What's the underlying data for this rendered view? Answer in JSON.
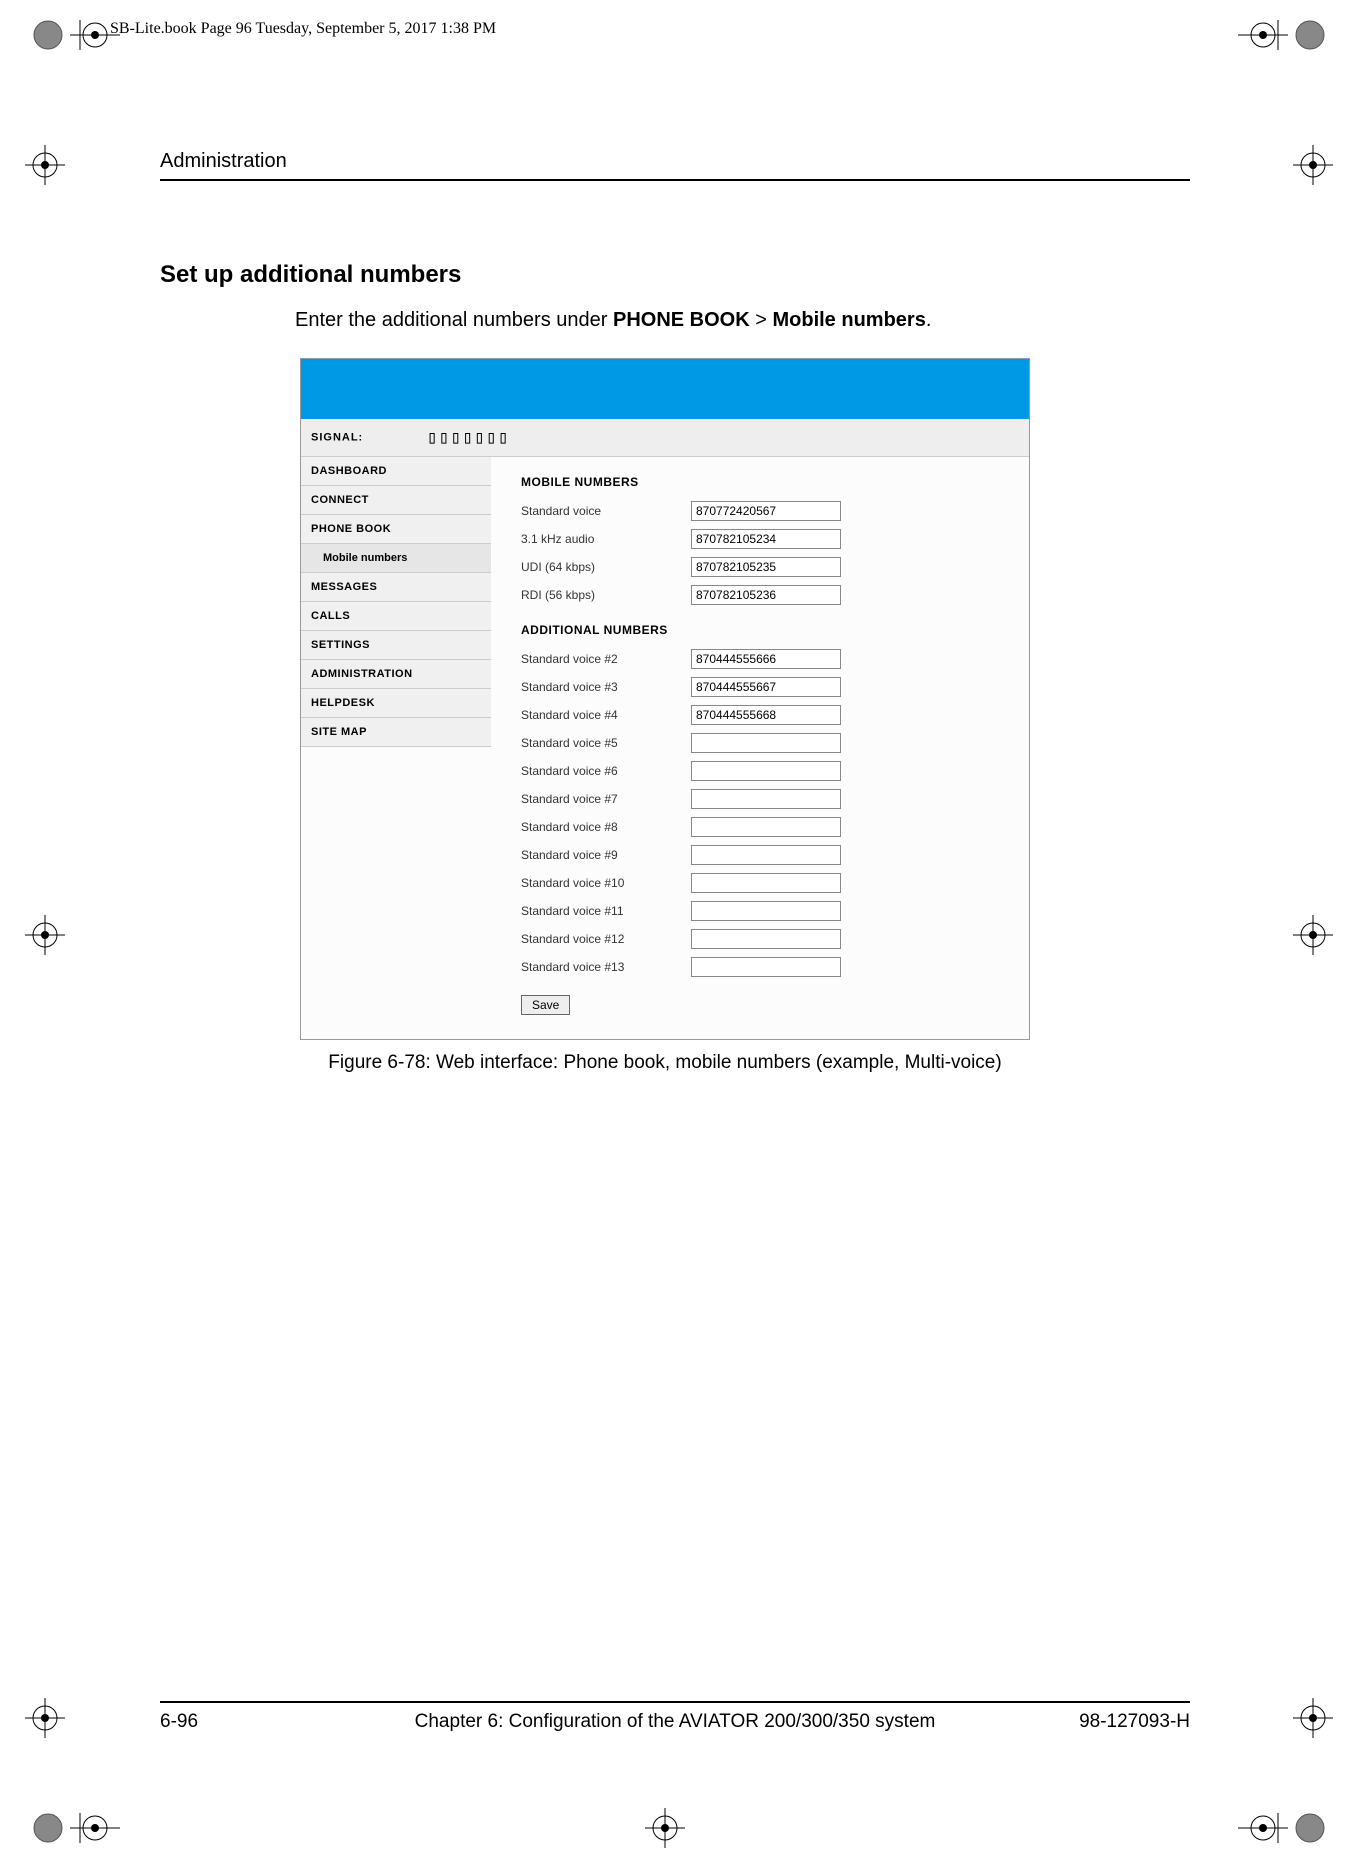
{
  "crop_header": "SB-Lite.book  Page 96  Tuesday, September 5, 2017  1:38 PM",
  "running_head": "Administration",
  "section_title": "Set up additional numbers",
  "body_text_prefix": "Enter the additional numbers under ",
  "body_text_bold1": "PHONE BOOK",
  "body_text_sep": " > ",
  "body_text_bold2": "Mobile numbers",
  "body_text_suffix": ".",
  "figure_caption": "Figure 6-78: Web interface: Phone book, mobile numbers (example, Multi-voice)",
  "footer": {
    "page": "6-96",
    "chapter": "Chapter 6:  Configuration of the AVIATOR 200/300/350 system",
    "docnum": "98-127093-H"
  },
  "webui": {
    "signal_label": "SIGNAL:",
    "signal_bars": "▯▯▯▯▯▯▯",
    "nav": {
      "dashboard": "DASHBOARD",
      "connect": "CONNECT",
      "phonebook": "PHONE BOOK",
      "mobile_numbers": "Mobile numbers",
      "messages": "MESSAGES",
      "calls": "CALLS",
      "settings": "SETTINGS",
      "administration": "ADMINISTRATION",
      "helpdesk": "HELPDESK",
      "sitemap": "SITE MAP"
    },
    "headings": {
      "mobile": "MOBILE NUMBERS",
      "additional": "ADDITIONAL NUMBERS"
    },
    "mobile_rows": [
      {
        "label": "Standard voice",
        "value": "870772420567"
      },
      {
        "label": "3.1 kHz audio",
        "value": "870782105234"
      },
      {
        "label": "UDI (64 kbps)",
        "value": "870782105235"
      },
      {
        "label": "RDI (56 kbps)",
        "value": "870782105236"
      }
    ],
    "additional_rows": [
      {
        "label": "Standard voice #2",
        "value": "870444555666"
      },
      {
        "label": "Standard voice #3",
        "value": "870444555667"
      },
      {
        "label": "Standard voice #4",
        "value": "870444555668"
      },
      {
        "label": "Standard voice #5",
        "value": ""
      },
      {
        "label": "Standard voice #6",
        "value": ""
      },
      {
        "label": "Standard voice #7",
        "value": ""
      },
      {
        "label": "Standard voice #8",
        "value": ""
      },
      {
        "label": "Standard voice #9",
        "value": ""
      },
      {
        "label": "Standard voice #10",
        "value": ""
      },
      {
        "label": "Standard voice #11",
        "value": ""
      },
      {
        "label": "Standard voice #12",
        "value": ""
      },
      {
        "label": "Standard voice #13",
        "value": ""
      }
    ],
    "save_label": "Save"
  }
}
